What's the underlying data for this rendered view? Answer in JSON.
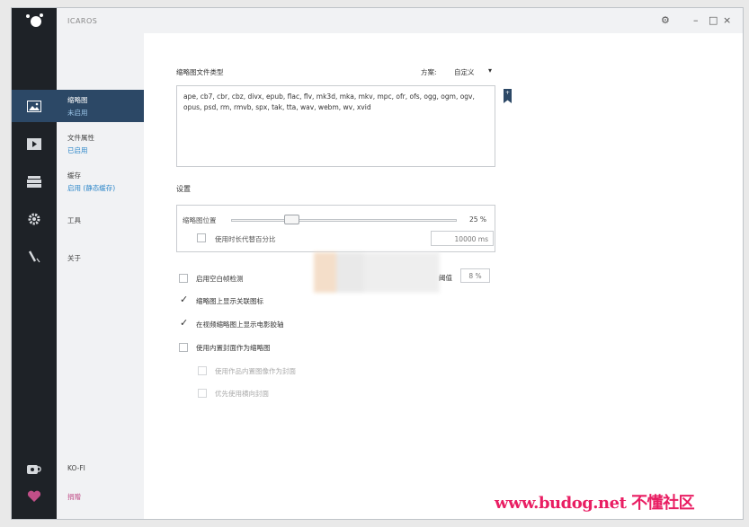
{
  "app": {
    "title": "ICAROS"
  },
  "titlebar": {
    "settings_icon": "gear-icon",
    "minimize": "–",
    "maximize": "□",
    "close": "×"
  },
  "rail": {
    "logo_icon": "logo-icon",
    "items": [
      {
        "icon": "image-icon",
        "glyph": "🖼"
      },
      {
        "icon": "play-icon",
        "glyph": "▶"
      },
      {
        "icon": "cache-icon",
        "glyph": "☰"
      },
      {
        "icon": "gear-icon",
        "glyph": "⚙"
      },
      {
        "icon": "pen-icon",
        "glyph": "✎"
      }
    ],
    "bottom": [
      {
        "icon": "coffee-icon",
        "glyph": "☕"
      },
      {
        "icon": "heart-icon",
        "glyph": "♥"
      }
    ]
  },
  "nav": {
    "items": [
      {
        "title": "缩略图",
        "status": "未启用"
      },
      {
        "title": "文件属性",
        "status": "已启用"
      },
      {
        "title": "缓存",
        "status": "启用 (静态缓存)"
      },
      {
        "title": "工具",
        "status": ""
      },
      {
        "title": "关于",
        "status": ""
      }
    ],
    "kofi": "KO-FI",
    "donate": "捐赠"
  },
  "main": {
    "file_types_label": "缩略图文件类型",
    "scheme_label": "方案:",
    "scheme_value": "自定义",
    "scheme_arrow": "▾",
    "extensions": "ape, cb7, cbr, cbz, divx, epub, flac, flv, mk3d, mka, mkv, mpc, ofr, ofs, ogg, ogm, ogv, opus, psd, rm, rmvb, spx, tak, tta, wav, webm, wv, xvid",
    "bookmark_glyph": "+",
    "settings_title": "设置",
    "slider_label": "缩略图位置",
    "slider_value": "25 %",
    "slider_fraction": 0.25,
    "duration_check_label": "使用时长代替百分比",
    "duration_input": "10000 ms",
    "options": [
      {
        "label": "启用空白帧检测",
        "checked": false,
        "dim": false
      },
      {
        "label": "缩略图上显示关联图标",
        "checked": true,
        "dim": false
      },
      {
        "label": "在视频缩略图上显示电影胶轴",
        "checked": true,
        "dim": false
      },
      {
        "label": "使用内置封面作为缩略图",
        "checked": false,
        "dim": false
      },
      {
        "label": "使用作品内置图像作为封面",
        "checked": false,
        "dim": true
      },
      {
        "label": "优先使用横向封面",
        "checked": false,
        "dim": true
      }
    ],
    "threshold_label": "阈值",
    "threshold_value": "8 %"
  },
  "colors": {
    "accent": "#2c4866",
    "link": "#2c86c9",
    "rail_bg": "#1e2227",
    "heart": "#c14f88"
  },
  "watermark": "www.budog.net 不懂社区"
}
